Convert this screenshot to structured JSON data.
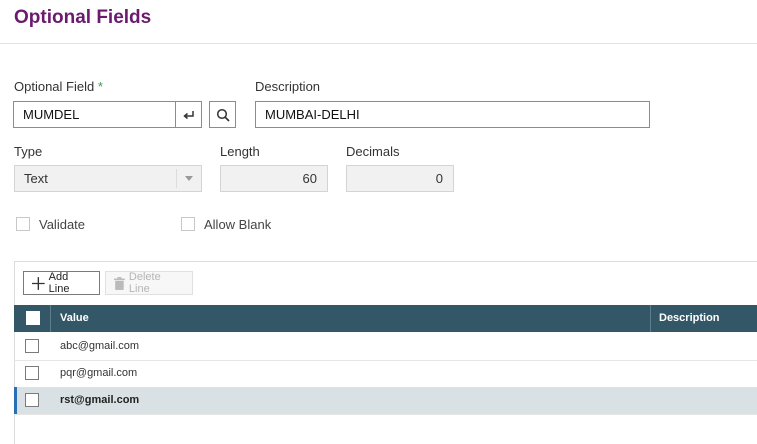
{
  "page": {
    "title": "Optional Fields"
  },
  "form": {
    "optional_field": {
      "label": "Optional Field",
      "required_marker": "*",
      "value": "MUMDEL"
    },
    "description": {
      "label": "Description",
      "value": "MUMBAI-DELHI"
    },
    "type": {
      "label": "Type",
      "value": "Text"
    },
    "length": {
      "label": "Length",
      "value": "60"
    },
    "decimals": {
      "label": "Decimals",
      "value": "0"
    },
    "validate": {
      "label": "Validate",
      "checked": false
    },
    "allow_blank": {
      "label": "Allow Blank",
      "checked": false
    }
  },
  "grid": {
    "add_line_label": "Add Line",
    "delete_line_label": "Delete Line",
    "columns": [
      "Value",
      "Description"
    ],
    "rows": [
      {
        "value": "abc@gmail.com",
        "description": "",
        "selected": false
      },
      {
        "value": "pqr@gmail.com",
        "description": "",
        "selected": false
      },
      {
        "value": "rst@gmail.com",
        "description": "",
        "selected": true
      }
    ]
  },
  "colors": {
    "title": "#6b1a6e",
    "header_bg": "#335766",
    "selected_row": "#d9e1e5",
    "accent": "#2a6fb5"
  },
  "icons": [
    "enter-icon",
    "search-icon",
    "dropdown-caret-icon",
    "plus-icon",
    "trash-icon"
  ]
}
